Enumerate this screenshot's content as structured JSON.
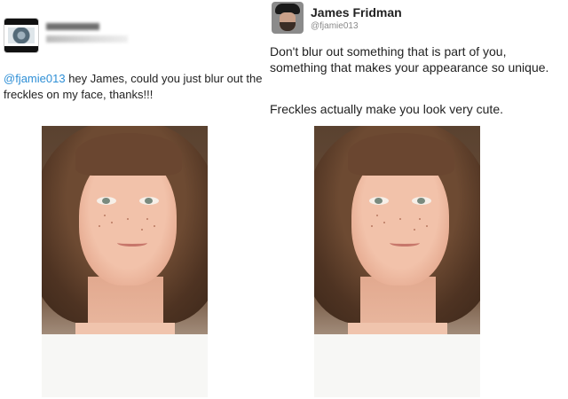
{
  "left_tweet": {
    "mention": "@fjamie013",
    "text": " hey James, could you just blur out the freckles on my face, thanks!!!",
    "avatar_icon": "profile-avatar-icon",
    "name_visible": false,
    "handle_visible": false
  },
  "right_tweet": {
    "author_name": "James Fridman",
    "author_handle": "@fjamie013",
    "reply_line_1": "Don't blur out something that is part of you, something that makes your appearance so unique.",
    "reply_line_2": "Freckles actually make you look very cute.",
    "avatar_icon": "profile-avatar-icon"
  },
  "colors": {
    "mention": "#2e8fd6",
    "text": "#222222",
    "handle": "#8a8a8a",
    "background": "#ffffff"
  }
}
